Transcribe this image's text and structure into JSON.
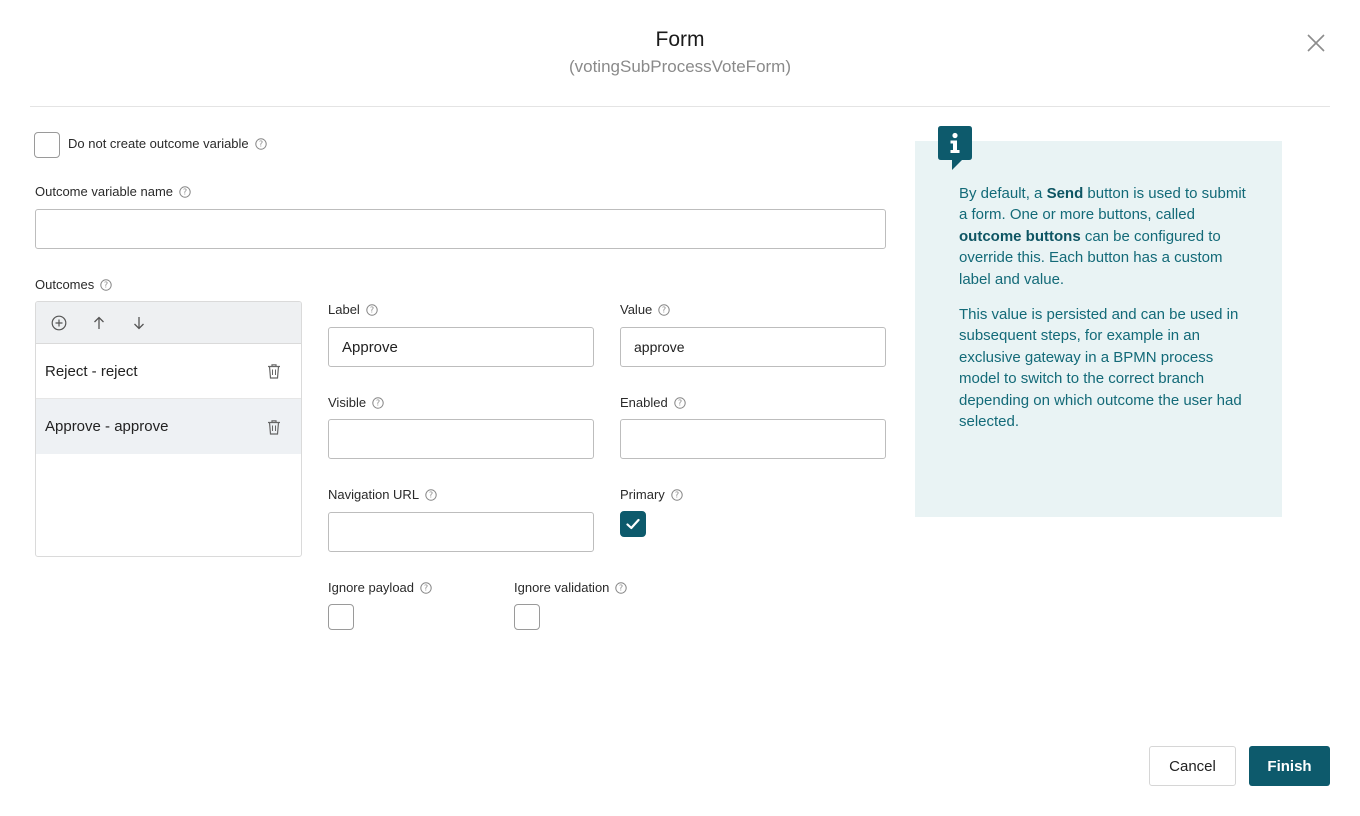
{
  "header": {
    "title": "Form",
    "subtitle": "(votingSubProcessVoteForm)"
  },
  "outcome_options": {
    "no_outcome_variable_label": "Do not create outcome variable",
    "no_outcome_variable_checked": false,
    "variable_name_label": "Outcome variable name",
    "variable_name_value": ""
  },
  "outcomes": {
    "label": "Outcomes",
    "items": [
      {
        "text": "Reject - reject",
        "selected": false
      },
      {
        "text": "Approve - approve",
        "selected": true
      }
    ]
  },
  "details": {
    "label_label": "Label",
    "label_value": "Approve",
    "value_label": "Value",
    "value_value": "approve",
    "visible_label": "Visible",
    "visible_value": "",
    "enabled_label": "Enabled",
    "enabled_value": "",
    "navigation_url_label": "Navigation URL",
    "navigation_url_value": "",
    "primary_label": "Primary",
    "primary_checked": true,
    "ignore_payload_label": "Ignore payload",
    "ignore_payload_checked": false,
    "ignore_validation_label": "Ignore validation",
    "ignore_validation_checked": false
  },
  "info": {
    "p1_a": "By default, a ",
    "p1_b": "Send",
    "p1_c": " button is used to submit a form. One or more buttons, called ",
    "p1_d": "outcome buttons",
    "p1_e": " can be configured to override this. Each button has a custom label and value.",
    "p2": "This value is persisted and can be used in subsequent steps, for example in an exclusive gateway in a BPMN process model to switch to the correct branch depending on which outcome the user had selected."
  },
  "footer": {
    "cancel_label": "Cancel",
    "finish_label": "Finish"
  },
  "icons": {
    "close": "close-icon",
    "help": "help-circle-icon",
    "add": "add-circle-icon",
    "up": "arrow-up-icon",
    "down": "arrow-down-icon",
    "trash": "trash-icon",
    "info": "info-icon",
    "check": "check-icon"
  },
  "colors": {
    "accent": "#0d5a6c",
    "info_bg": "#e9f3f4",
    "info_text": "#136a78"
  }
}
